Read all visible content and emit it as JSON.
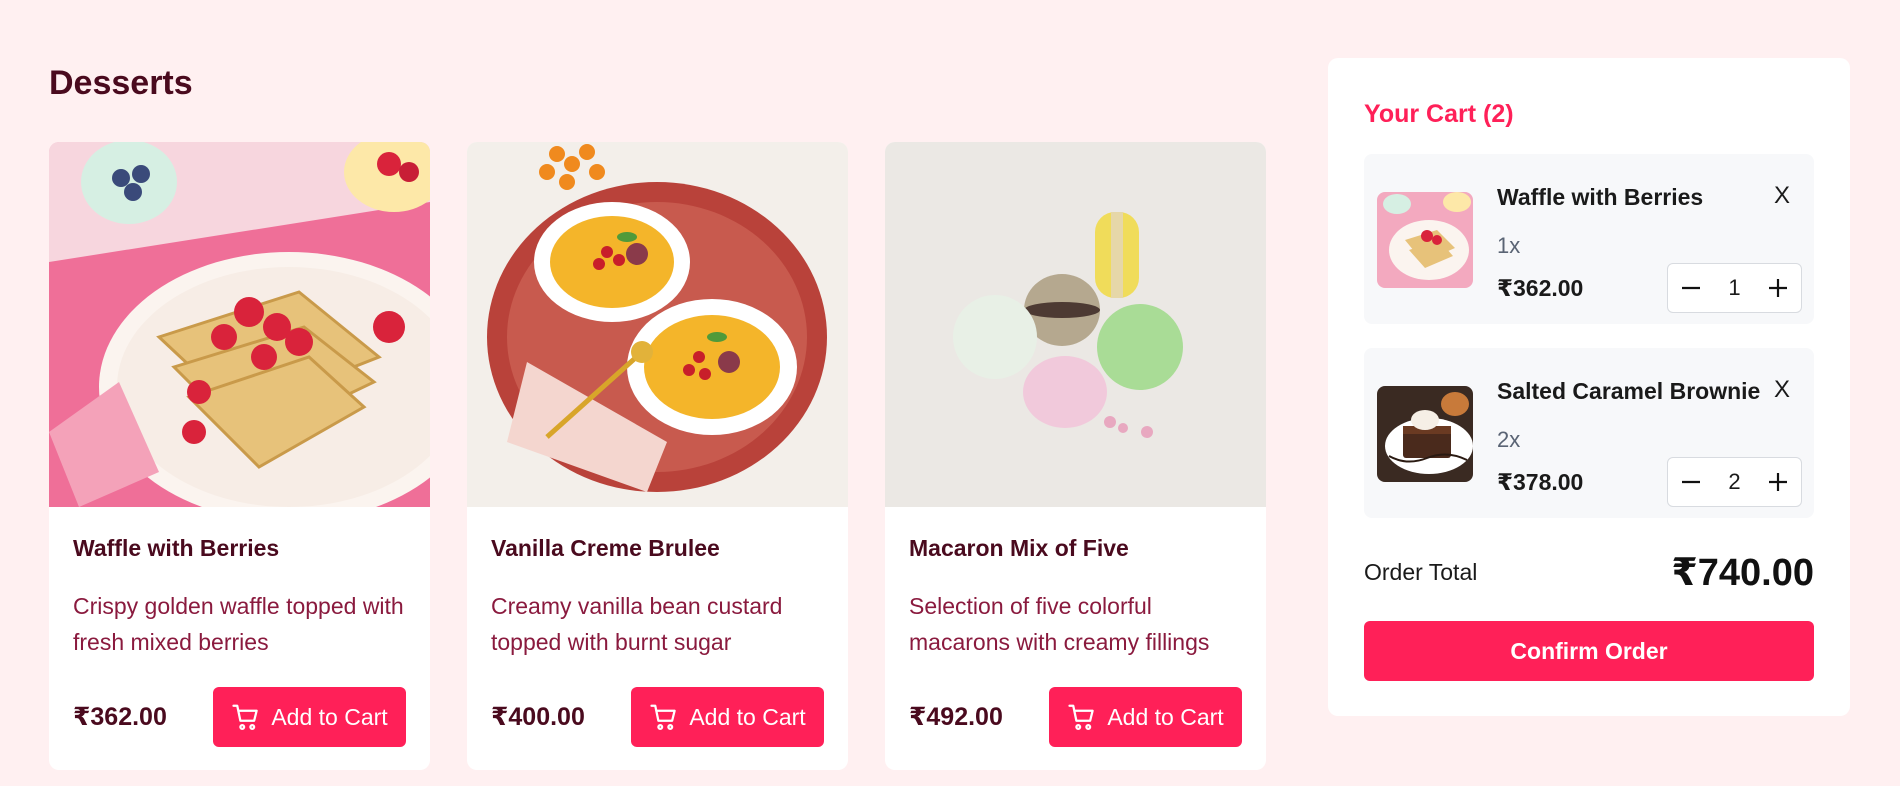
{
  "section_title": "Desserts",
  "currency_symbol": "₹",
  "products": [
    {
      "name": "Waffle with Berries",
      "description": "Crispy golden waffle topped with fresh mixed berries",
      "price": "₹362.00",
      "add_label": "Add to Cart",
      "image_icon": "waffle-image"
    },
    {
      "name": "Vanilla Creme Brulee",
      "description": "Creamy vanilla bean custard topped with burnt sugar",
      "price": "₹400.00",
      "add_label": "Add to Cart",
      "image_icon": "creme-brulee-image"
    },
    {
      "name": "Macaron Mix of Five",
      "description": "Selection of five colorful macarons with creamy fillings",
      "price": "₹492.00",
      "add_label": "Add to Cart",
      "image_icon": "macaron-image"
    }
  ],
  "cart": {
    "title": "Your Cart (2)",
    "items": [
      {
        "name": "Waffle with Berries",
        "remove_label": "X",
        "qty_label": "1x",
        "price": "₹362.00",
        "qty": "1"
      },
      {
        "name": "Salted Caramel Brownie",
        "remove_label": "X",
        "qty_label": "2x",
        "price": "₹378.00",
        "qty": "2"
      }
    ],
    "total_label": "Order Total",
    "total_value": "₹740.00",
    "confirm_label": "Confirm Order"
  },
  "colors": {
    "accent": "#ff2058",
    "background": "#fff0f1",
    "heading": "#4a0a1e",
    "description": "#8a1a3e"
  }
}
